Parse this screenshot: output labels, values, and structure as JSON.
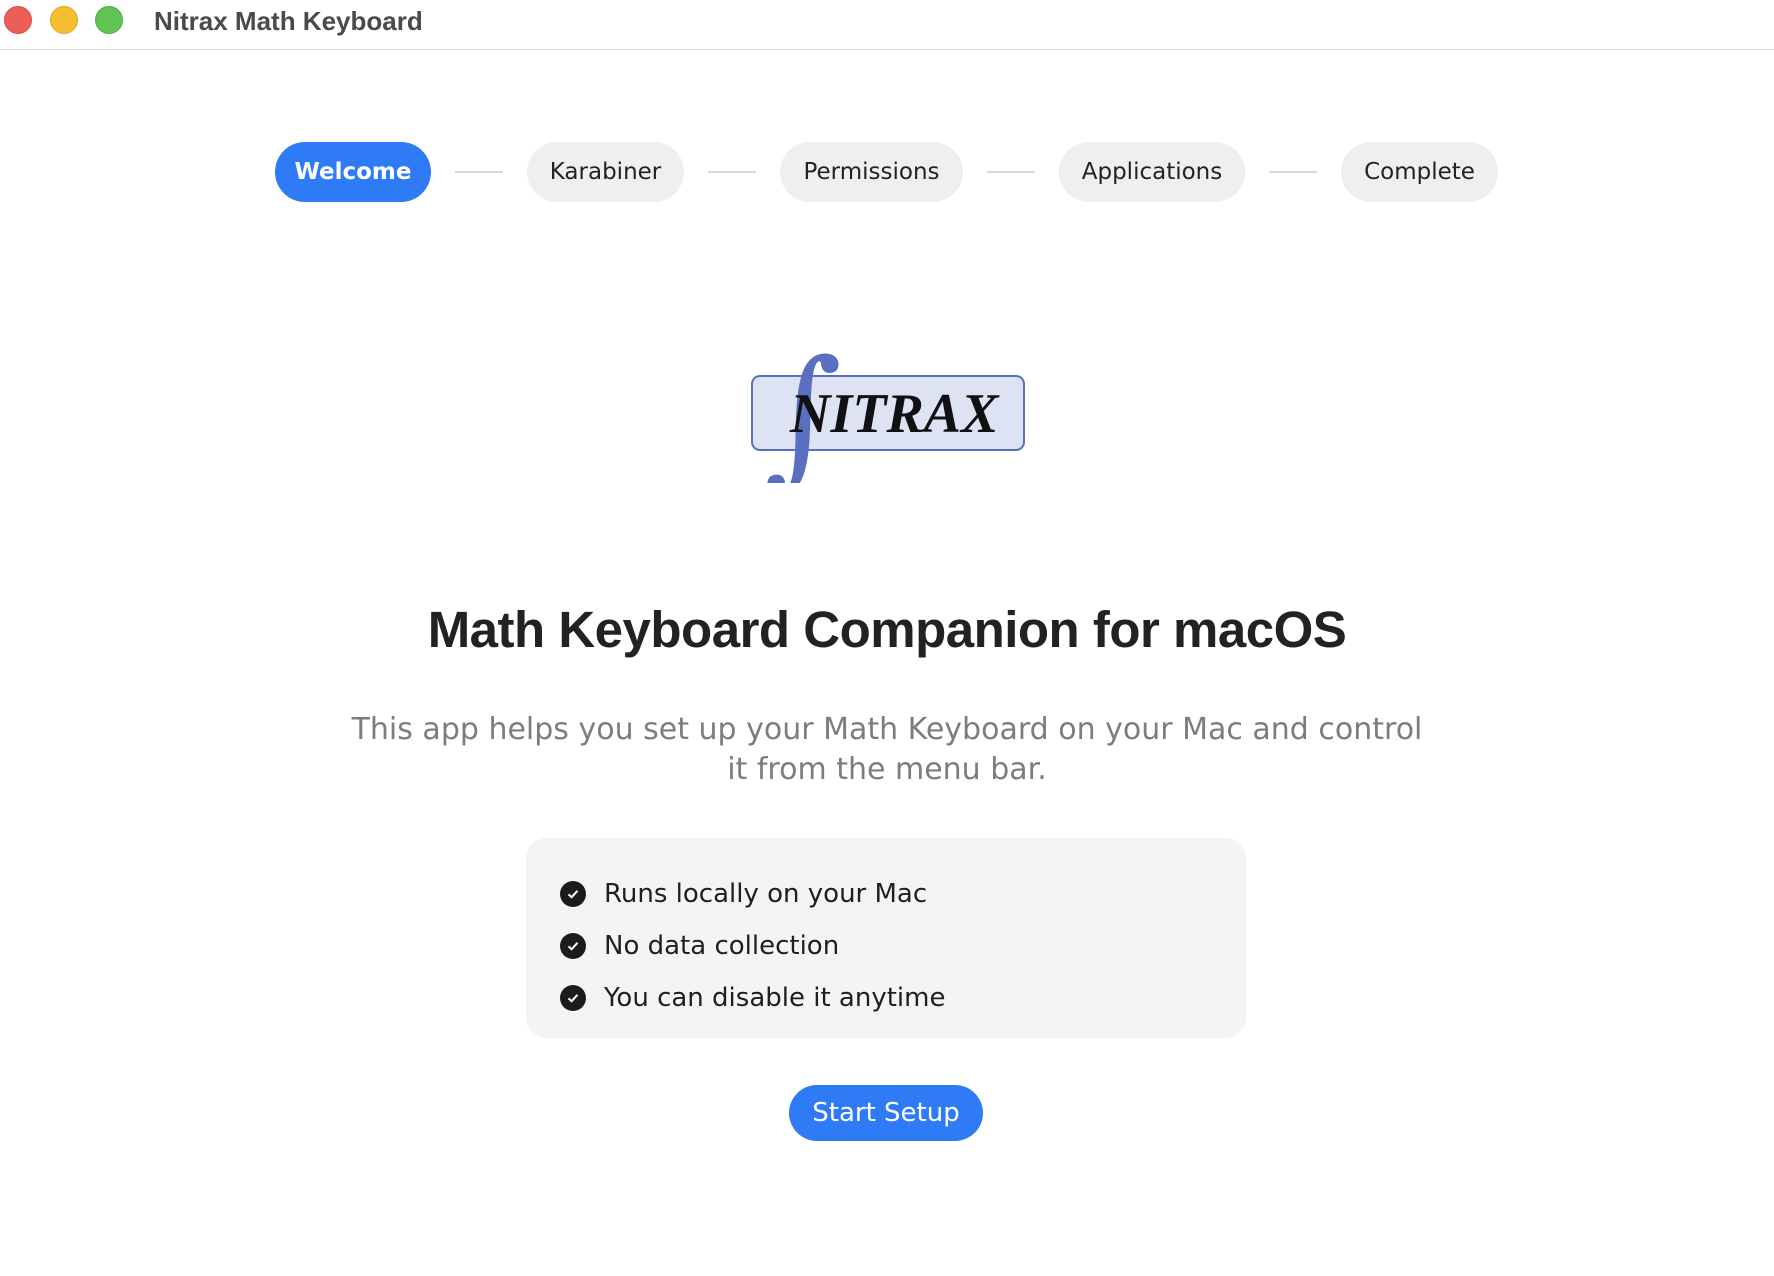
{
  "window": {
    "title": "Nitrax Math Keyboard"
  },
  "steps": [
    {
      "label": "Welcome",
      "active": true
    },
    {
      "label": "Karabiner",
      "active": false
    },
    {
      "label": "Permissions",
      "active": false
    },
    {
      "label": "Applications",
      "active": false
    },
    {
      "label": "Complete",
      "active": false
    }
  ],
  "logo": {
    "text": "NITRAX",
    "symbol": "∫",
    "accent_color": "#5a6fbf",
    "box_fill": "#dde3f3"
  },
  "main": {
    "heading": "Math Keyboard Companion for macOS",
    "subtitle": "This app helps you set up your Math Keyboard on your Mac and control it from the menu bar."
  },
  "features": [
    {
      "icon": "checkmark-circle-icon",
      "label": "Runs locally on your Mac"
    },
    {
      "icon": "checkmark-circle-icon",
      "label": "No data collection"
    },
    {
      "icon": "checkmark-circle-icon",
      "label": "You can disable it anytime"
    }
  ],
  "actions": {
    "start_label": "Start Setup"
  },
  "colors": {
    "accent": "#2f7bf6",
    "pill_inactive": "#efefef",
    "features_bg": "#f4f4f4"
  }
}
